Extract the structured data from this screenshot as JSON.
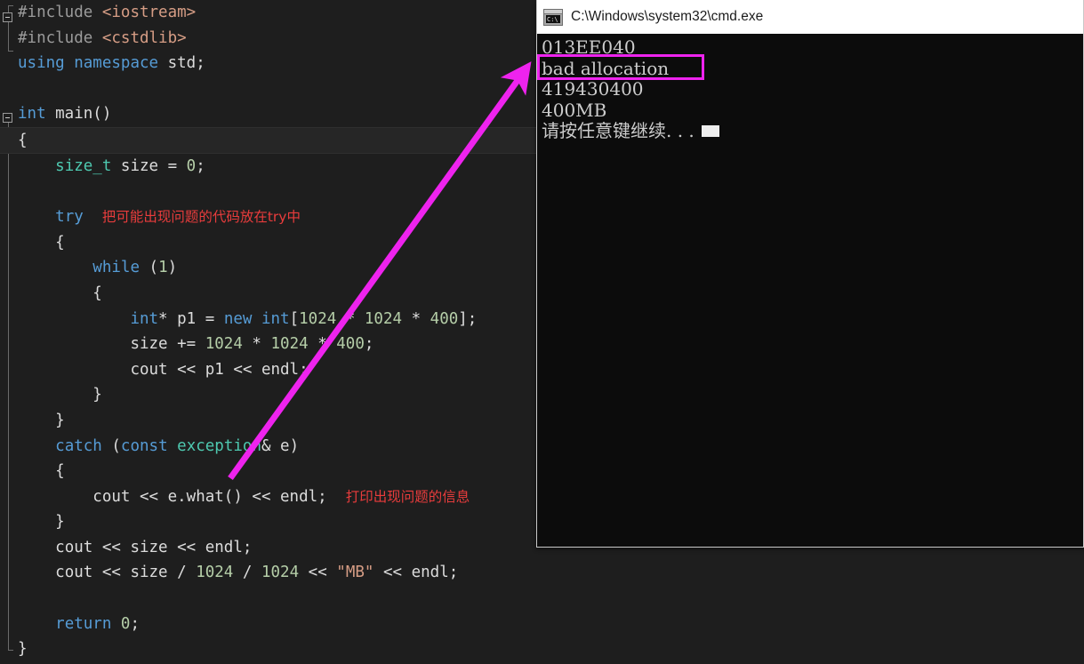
{
  "editor": {
    "name": "visual-studio-code-editor",
    "theme_background": "#1e1e1e",
    "current_line_index": 5,
    "lines": [
      {
        "indent": 0,
        "tokens": [
          {
            "t": "#include",
            "c": "pp"
          },
          {
            "t": " ",
            "c": "plain"
          },
          {
            "t": "<iostream>",
            "c": "str"
          }
        ]
      },
      {
        "indent": 0,
        "tokens": [
          {
            "t": "#include",
            "c": "pp"
          },
          {
            "t": " ",
            "c": "plain"
          },
          {
            "t": "<cstdlib>",
            "c": "str"
          }
        ]
      },
      {
        "indent": 0,
        "tokens": [
          {
            "t": "using",
            "c": "kw"
          },
          {
            "t": " ",
            "c": "plain"
          },
          {
            "t": "namespace",
            "c": "kw"
          },
          {
            "t": " std;",
            "c": "plain"
          }
        ]
      },
      {
        "indent": 0,
        "tokens": []
      },
      {
        "indent": 0,
        "tokens": [
          {
            "t": "int",
            "c": "kw"
          },
          {
            "t": " main()",
            "c": "plain"
          }
        ]
      },
      {
        "indent": 0,
        "tokens": [
          {
            "t": "{",
            "c": "brace"
          }
        ]
      },
      {
        "indent": 1,
        "tokens": [
          {
            "t": "size_t",
            "c": "type"
          },
          {
            "t": " size = ",
            "c": "plain"
          },
          {
            "t": "0",
            "c": "num"
          },
          {
            "t": ";",
            "c": "plain"
          }
        ]
      },
      {
        "indent": 0,
        "tokens": []
      },
      {
        "indent": 1,
        "tokens": [
          {
            "t": "try",
            "c": "kw"
          },
          {
            "t": "  ",
            "c": "plain"
          },
          {
            "t": "把可能出现问题的代码放在try中",
            "c": "cmt-cn"
          }
        ]
      },
      {
        "indent": 1,
        "tokens": [
          {
            "t": "{",
            "c": "brace"
          }
        ]
      },
      {
        "indent": 2,
        "tokens": [
          {
            "t": "while",
            "c": "kw"
          },
          {
            "t": " (",
            "c": "plain"
          },
          {
            "t": "1",
            "c": "num"
          },
          {
            "t": ")",
            "c": "plain"
          }
        ]
      },
      {
        "indent": 2,
        "tokens": [
          {
            "t": "{",
            "c": "brace"
          }
        ]
      },
      {
        "indent": 3,
        "tokens": [
          {
            "t": "int",
            "c": "kw"
          },
          {
            "t": "* p1 = ",
            "c": "plain"
          },
          {
            "t": "new",
            "c": "kw"
          },
          {
            "t": " ",
            "c": "plain"
          },
          {
            "t": "int",
            "c": "kw"
          },
          {
            "t": "[",
            "c": "plain"
          },
          {
            "t": "1024",
            "c": "num"
          },
          {
            "t": " * ",
            "c": "plain"
          },
          {
            "t": "1024",
            "c": "num"
          },
          {
            "t": " * ",
            "c": "plain"
          },
          {
            "t": "400",
            "c": "num"
          },
          {
            "t": "];",
            "c": "plain"
          }
        ]
      },
      {
        "indent": 3,
        "tokens": [
          {
            "t": "size += ",
            "c": "plain"
          },
          {
            "t": "1024",
            "c": "num"
          },
          {
            "t": " * ",
            "c": "plain"
          },
          {
            "t": "1024",
            "c": "num"
          },
          {
            "t": " * ",
            "c": "plain"
          },
          {
            "t": "400",
            "c": "num"
          },
          {
            "t": ";",
            "c": "plain"
          }
        ]
      },
      {
        "indent": 3,
        "tokens": [
          {
            "t": "cout << p1 << endl;",
            "c": "plain"
          }
        ]
      },
      {
        "indent": 2,
        "tokens": [
          {
            "t": "}",
            "c": "brace"
          }
        ]
      },
      {
        "indent": 1,
        "tokens": [
          {
            "t": "}",
            "c": "brace"
          }
        ]
      },
      {
        "indent": 1,
        "tokens": [
          {
            "t": "catch",
            "c": "kw"
          },
          {
            "t": " (",
            "c": "plain"
          },
          {
            "t": "const",
            "c": "kw"
          },
          {
            "t": " ",
            "c": "plain"
          },
          {
            "t": "exception",
            "c": "type"
          },
          {
            "t": "& e)",
            "c": "plain"
          }
        ]
      },
      {
        "indent": 1,
        "tokens": [
          {
            "t": "{",
            "c": "brace"
          }
        ]
      },
      {
        "indent": 2,
        "tokens": [
          {
            "t": "cout << e.what() << endl;",
            "c": "plain"
          },
          {
            "t": "  ",
            "c": "plain"
          },
          {
            "t": "打印出现问题的信息",
            "c": "cmt-cn"
          }
        ]
      },
      {
        "indent": 1,
        "tokens": [
          {
            "t": "}",
            "c": "brace"
          }
        ]
      },
      {
        "indent": 1,
        "tokens": [
          {
            "t": "cout << size << endl;",
            "c": "plain"
          }
        ]
      },
      {
        "indent": 1,
        "tokens": [
          {
            "t": "cout << size / ",
            "c": "plain"
          },
          {
            "t": "1024",
            "c": "num"
          },
          {
            "t": " / ",
            "c": "plain"
          },
          {
            "t": "1024",
            "c": "num"
          },
          {
            "t": " << ",
            "c": "plain"
          },
          {
            "t": "\"MB\"",
            "c": "str"
          },
          {
            "t": " << endl;",
            "c": "plain"
          }
        ]
      },
      {
        "indent": 0,
        "tokens": []
      },
      {
        "indent": 1,
        "tokens": [
          {
            "t": "return",
            "c": "kw"
          },
          {
            "t": " ",
            "c": "plain"
          },
          {
            "t": "0",
            "c": "num"
          },
          {
            "t": ";",
            "c": "plain"
          }
        ]
      },
      {
        "indent": 0,
        "tokens": [
          {
            "t": "}",
            "c": "brace"
          }
        ]
      }
    ]
  },
  "annotations": {
    "try_comment": "把可能出现问题的代码放在try中",
    "catch_comment": "打印出现问题的信息",
    "arrow_color": "#ee23ee",
    "highlight_box_color": "#ee23ee",
    "highlight_box_target": "bad allocation"
  },
  "console": {
    "title": "C:\\Windows\\system32\\cmd.exe",
    "icon": "cmd-exe-icon",
    "icon_text": "C:\\",
    "background": "#0c0c0c",
    "foreground": "#cccccc",
    "lines": [
      "013EE040",
      "bad allocation",
      "419430400",
      "400MB",
      "请按任意键继续. . ."
    ]
  }
}
